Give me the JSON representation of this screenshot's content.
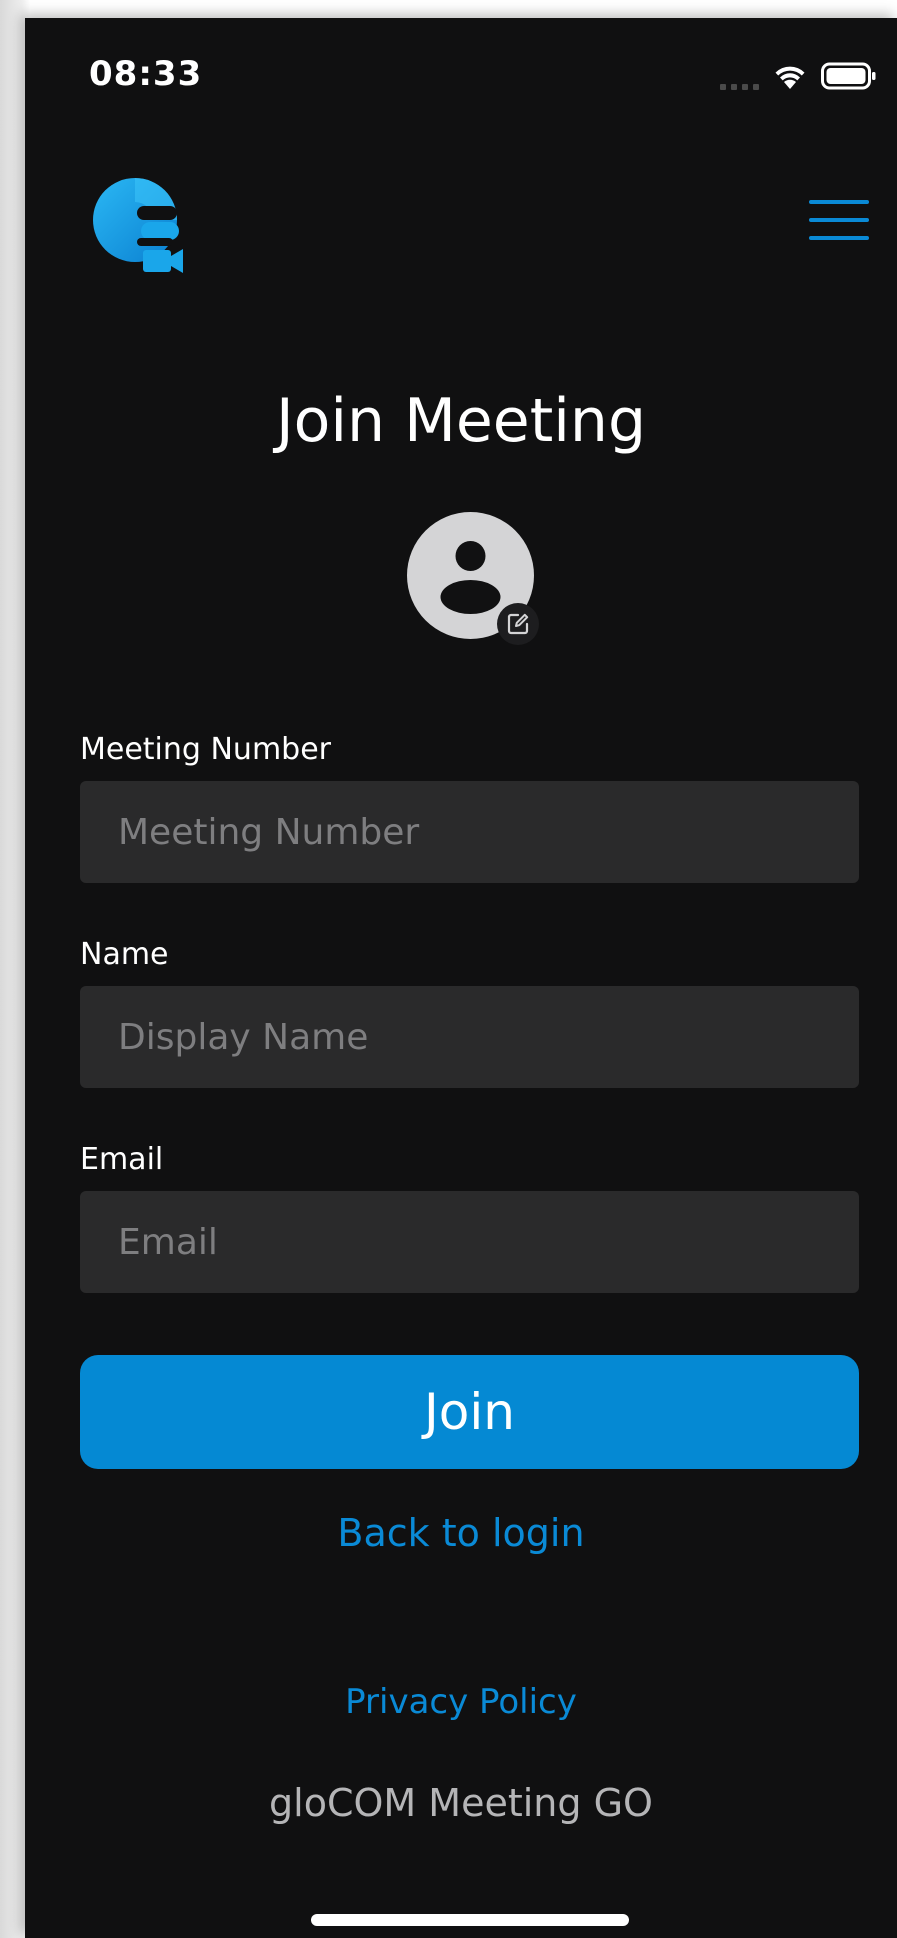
{
  "status_bar": {
    "time": "08:33"
  },
  "header": {
    "logo_name": "glocom-logo",
    "menu_icon": "hamburger-menu-icon"
  },
  "page": {
    "title": "Join Meeting"
  },
  "avatar": {
    "icon": "user-silhouette-icon",
    "edit_icon": "edit-pencil-icon"
  },
  "form": {
    "meeting_number": {
      "label": "Meeting Number",
      "placeholder": "Meeting Number",
      "value": ""
    },
    "name": {
      "label": "Name",
      "placeholder": "Display Name",
      "value": ""
    },
    "email": {
      "label": "Email",
      "placeholder": "Email",
      "value": ""
    },
    "join_label": "Join"
  },
  "links": {
    "back_to_login": "Back to login",
    "privacy_policy": "Privacy Policy"
  },
  "footer": {
    "app_name": "gloCOM Meeting GO"
  },
  "colors": {
    "background": "#101011",
    "accent": "#0589d3",
    "input_background": "#2a2a2b",
    "placeholder": "#7e7e80"
  }
}
